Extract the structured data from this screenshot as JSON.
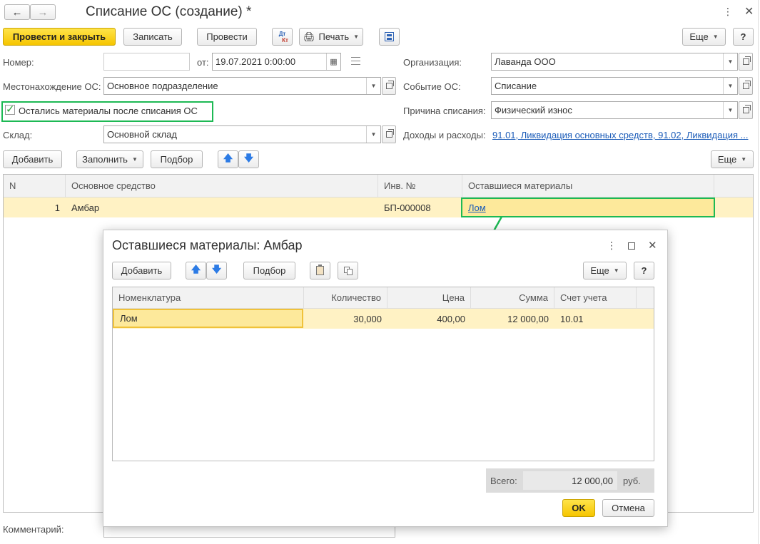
{
  "window": {
    "title": "Списание ОС (создание) *"
  },
  "toolbar": {
    "post_close": "Провести и закрыть",
    "write": "Записать",
    "post": "Провести",
    "dt_kt_top": "Дт",
    "dt_kt_bottom": "Кт",
    "print": "Печать",
    "more": "Еще",
    "help": "?"
  },
  "form": {
    "number_label": "Номер:",
    "number_value": "",
    "from_label": "от:",
    "date_value": "19.07.2021  0:00:00",
    "org_label": "Организация:",
    "org_value": "Лаванда ООО",
    "location_label": "Местонахождение ОС:",
    "location_value": "Основное подразделение",
    "event_label": "Событие ОС:",
    "event_value": "Списание",
    "materials_checkbox": "Остались материалы после списания ОС",
    "reason_label": "Причина списания:",
    "reason_value": "Физический износ",
    "warehouse_label": "Склад:",
    "warehouse_value": "Основной склад",
    "income_label": "Доходы и расходы:",
    "income_link": "91.01, Ликвидация основных средств, 91.02, Ликвидация ..."
  },
  "table_toolbar": {
    "add": "Добавить",
    "fill": "Заполнить",
    "select": "Подбор",
    "more": "Еще"
  },
  "table": {
    "columns": [
      "N",
      "Основное средство",
      "Инв. №",
      "Оставшиеся материалы"
    ],
    "rows": [
      {
        "n": "1",
        "asset": "Амбар",
        "inv": "БП-000008",
        "materials": "Лом"
      }
    ]
  },
  "comment_label": "Комментарий:",
  "dialog": {
    "title": "Оставшиеся материалы: Амбар",
    "add": "Добавить",
    "select": "Подбор",
    "more": "Еще",
    "help": "?",
    "columns": [
      "Номенклатура",
      "Количество",
      "Цена",
      "Сумма",
      "Счет учета"
    ],
    "rows": [
      {
        "item": "Лом",
        "qty": "30,000",
        "price": "400,00",
        "sum": "12 000,00",
        "account": "10.01"
      }
    ],
    "total_label": "Всего:",
    "total_value": "12 000,00",
    "total_currency": "руб.",
    "ok": "OK",
    "cancel": "Отмена"
  },
  "colors": {
    "accent_yellow": "#f6c500",
    "highlight_green": "#1db954",
    "selected_row": "#fff2c4",
    "link_blue": "#1a5bb8"
  }
}
